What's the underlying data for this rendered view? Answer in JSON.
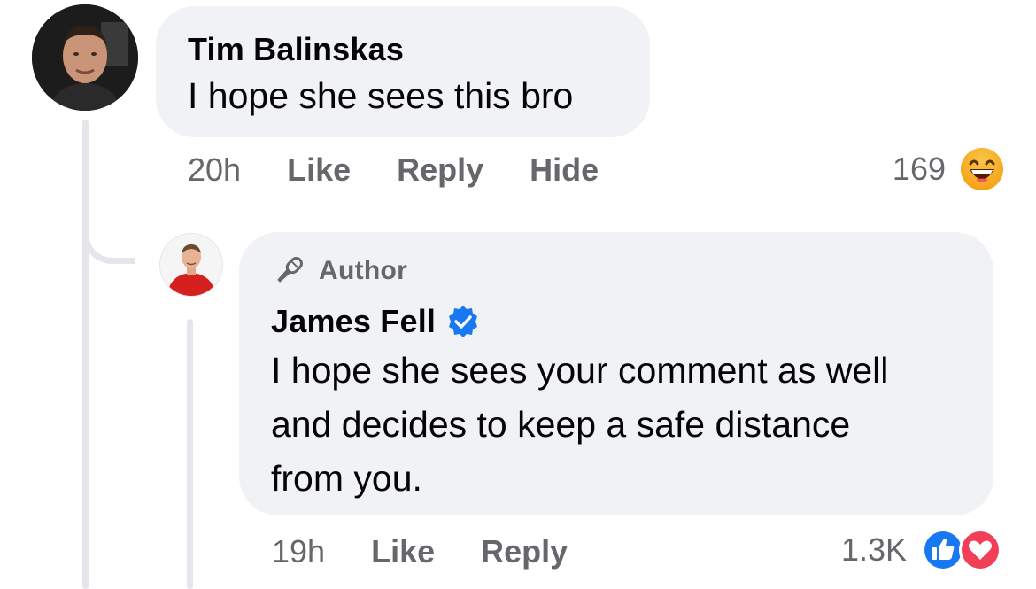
{
  "comment": {
    "author": "Tim Balinskas",
    "text": "I hope she sees this bro",
    "time": "20h",
    "actions": {
      "like": "Like",
      "reply": "Reply",
      "hide": "Hide"
    },
    "reaction_count": "169",
    "reaction_icons": [
      "laughing-emoji-icon"
    ]
  },
  "reply": {
    "badge": "Author",
    "author": "James Fell",
    "verified": true,
    "text": "I hope she sees your comment as well\nand decides to keep a safe distance\nfrom you.",
    "time": "19h",
    "actions": {
      "like": "Like",
      "reply": "Reply"
    },
    "reaction_count": "1.3K",
    "reaction_icons": [
      "like-reaction-icon",
      "love-reaction-icon"
    ]
  },
  "colors": {
    "bubble": "#f0f2f5",
    "meta_text": "#65676b",
    "thread_line": "#e4e6eb",
    "verified_blue": "#1877f2",
    "love_red": "#f33e58"
  }
}
